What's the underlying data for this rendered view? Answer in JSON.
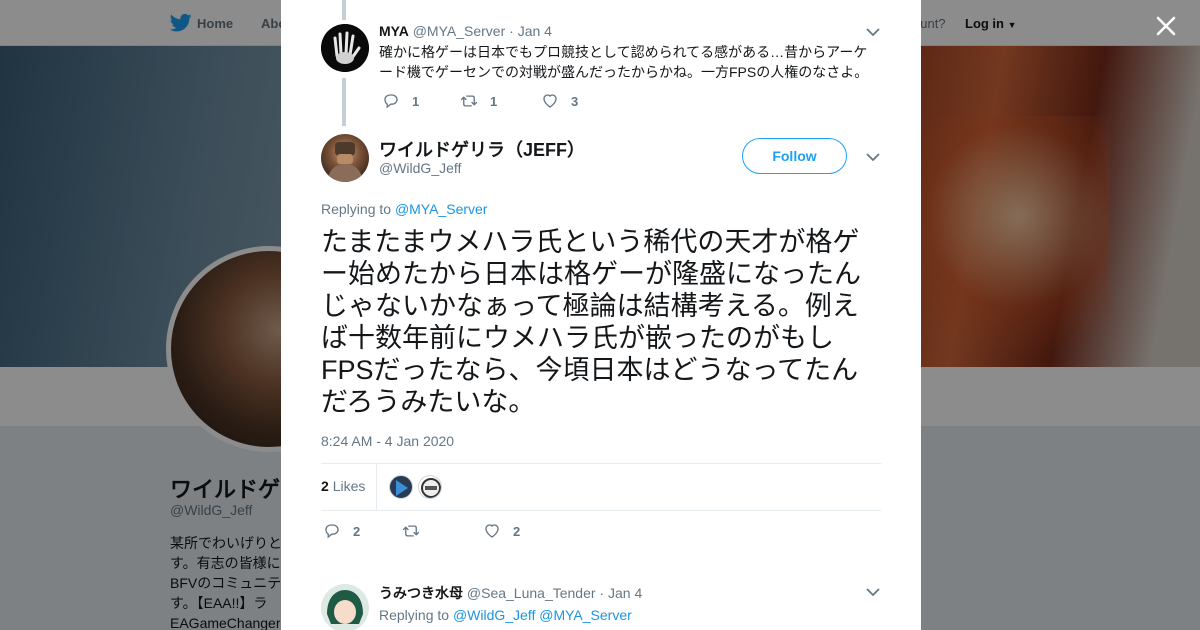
{
  "topnav": {
    "home_label": "Home",
    "about_label": "Abo",
    "account_prompt": "ccount?",
    "login_label": "Log in"
  },
  "profile": {
    "name": "ワイルドゲ",
    "handle": "@WildG_Jeff",
    "bio_lines": [
      "某所でわいげりと",
      "す。有志の皆様に",
      "BFVのコミュニテ",
      "す。【EAA!!】ラ",
      "EAGameChanger"
    ]
  },
  "thread_tweet": {
    "name": "MYA",
    "handle": "@MYA_Server",
    "date": "· Jan 4",
    "text_line1": "確かに格ゲーは日本でもプロ競技として認められてる感がある…昔からアーケ",
    "text_line2": "ード機でゲーセンでの対戦が盛んだったからかね。一方FPSの人権のなさよ。",
    "replies": "1",
    "retweets": "1",
    "likes": "3"
  },
  "main_tweet": {
    "name": "ワイルドゲリラ（JEFF）",
    "handle": "@WildG_Jeff",
    "follow_label": "Follow",
    "replying_prefix": "Replying to",
    "replying_to": "@MYA_Server",
    "text": "たまたまウメハラ氏という稀代の天才が格ゲー始めたから日本は格ゲーが隆盛になったんじゃないかなぁって極論は結構考える。例えば十数年前にウメハラ氏が嵌ったのがもしFPSだったなら、今頃日本はどうなってたんだろうみたいな。",
    "timestamp": "8:24 AM - 4 Jan 2020",
    "likes_count": "2",
    "likes_label": "Likes",
    "replies": "2",
    "retweets": "",
    "likes": "2"
  },
  "reply_tweet": {
    "name": "うみつき水母",
    "handle": "@Sea_Luna_Tender",
    "date": "· Jan 4",
    "replying_prefix": "Replying to",
    "replying_to_1": "@WildG_Jeff",
    "replying_to_2": "@MYA_Server"
  },
  "colors": {
    "twitter_blue": "#1da1f2",
    "link_blue": "#1b95e0",
    "muted_gray": "#657786",
    "text_dark": "#14171a"
  },
  "icons": [
    "twitter-bird-icon",
    "close-icon",
    "chevron-down-icon",
    "reply-icon",
    "retweet-icon",
    "heart-icon"
  ]
}
